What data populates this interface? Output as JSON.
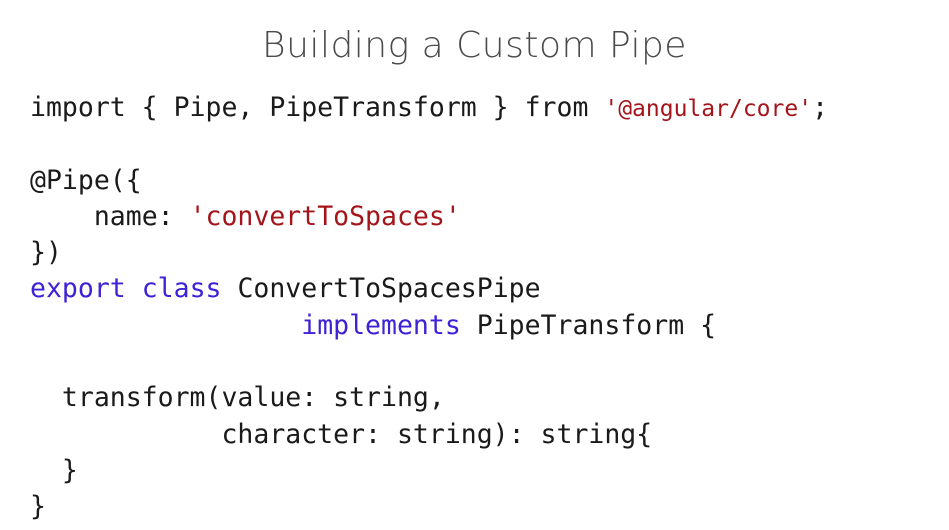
{
  "title": "Building a Custom Pipe",
  "colors": {
    "keyword": "#3d22d6",
    "string": "#a3151b",
    "text": "#1a1a1a",
    "title": "#4a4a4a"
  },
  "code": {
    "l1_a": "import { Pipe, PipeTransform } from ",
    "l1_str": "'@angular/core'",
    "l1_end": ";",
    "l3": "@Pipe({",
    "l4_indent": "    ",
    "l4_key": "name: ",
    "l4_str": "'convertToSpaces'",
    "l5": "})",
    "l6_kw1": "export",
    "l6_sp1": " ",
    "l6_kw2": "class",
    "l6_rest": " ConvertToSpacesPipe",
    "l7_indent": "                 ",
    "l7_kw": "implements",
    "l7_rest": " PipeTransform {",
    "l9": "  transform(value: string,",
    "l10": "            character: string): string{",
    "l11": "  }",
    "l12": "}"
  }
}
